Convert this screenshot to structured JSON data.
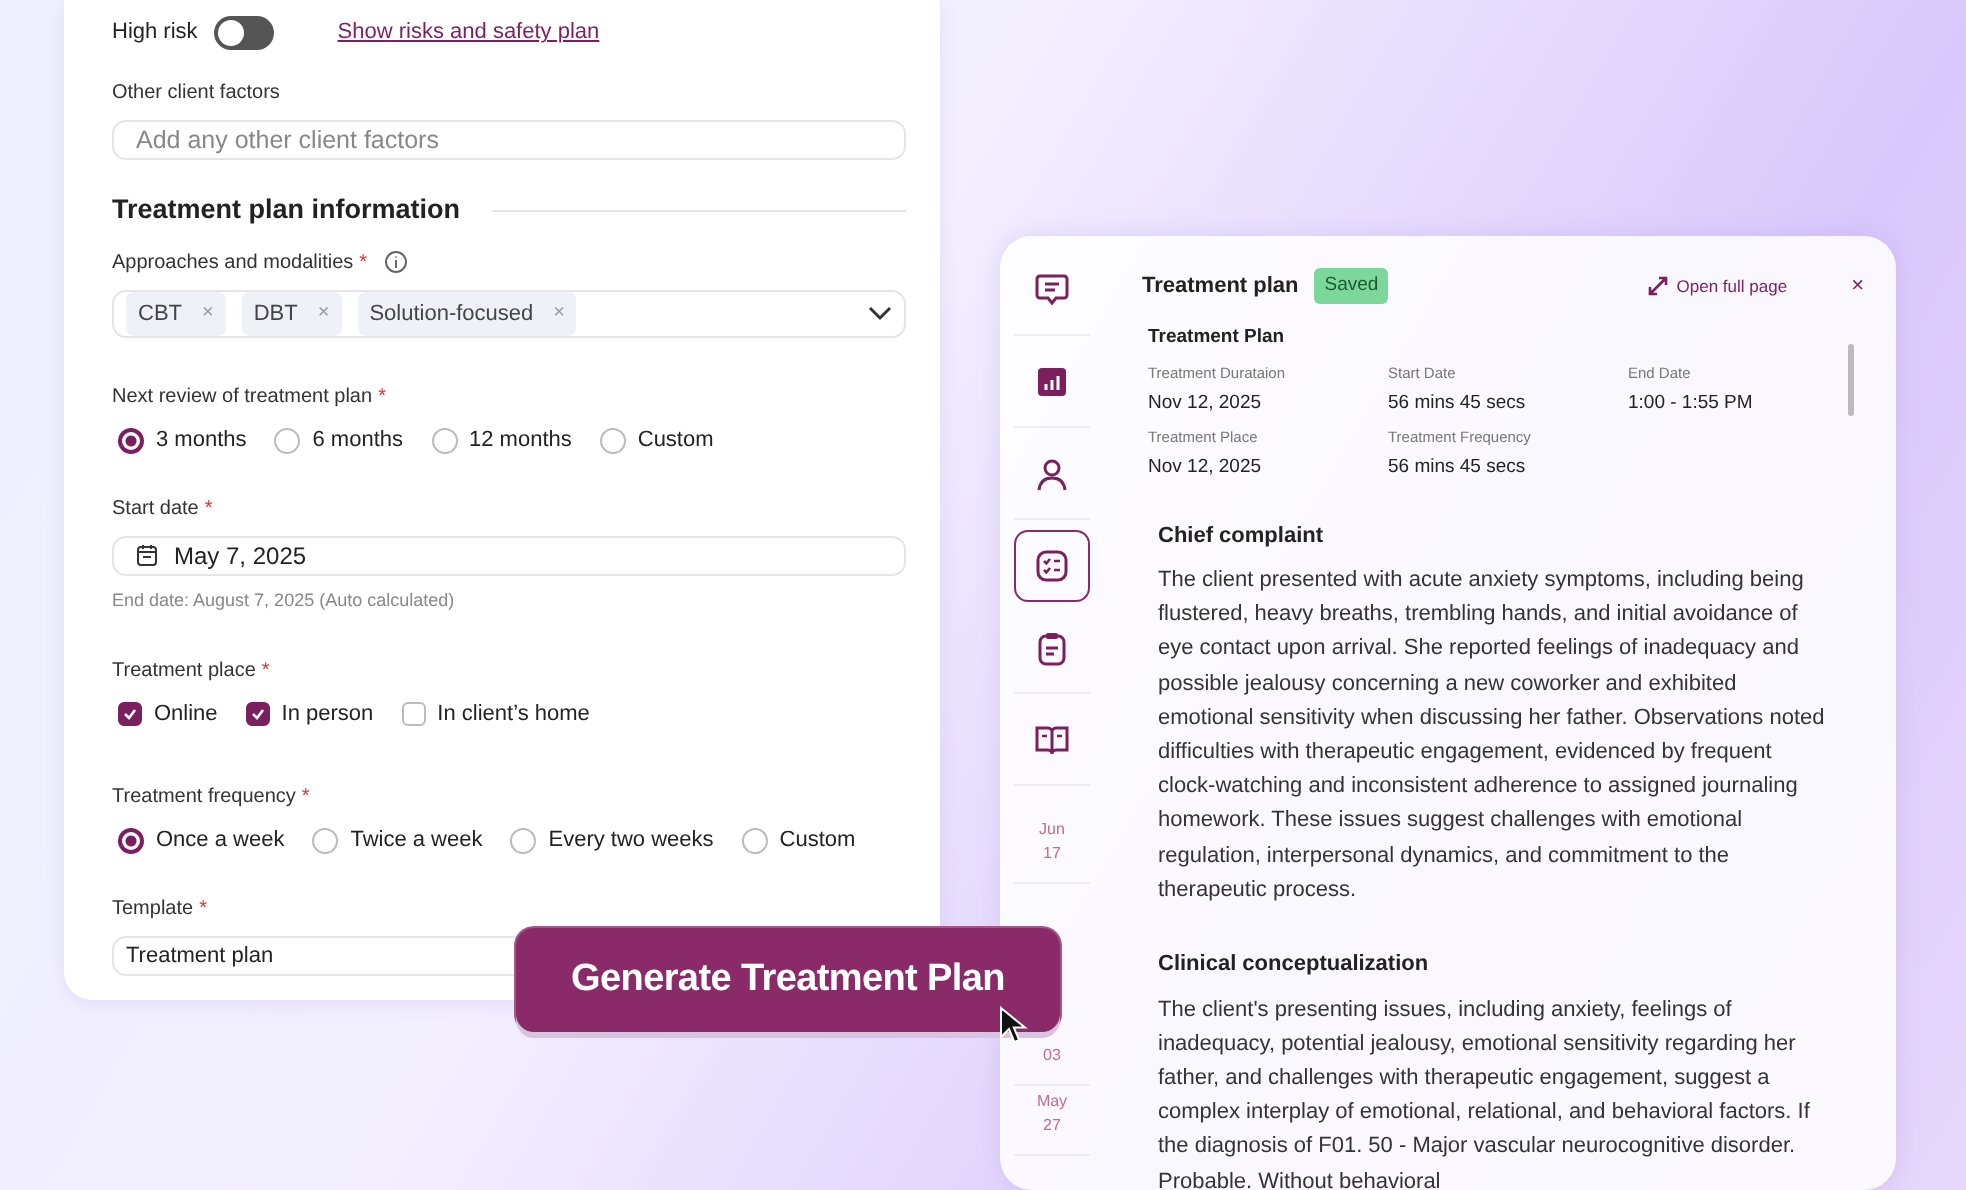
{
  "form": {
    "high_risk": {
      "label": "High risk",
      "on": false
    },
    "safety_link": "Show risks and safety plan",
    "other_factors": {
      "label": "Other client factors",
      "placeholder": "Add any other client factors"
    },
    "section_title": "Treatment plan information",
    "approaches": {
      "label": "Approaches and modalities",
      "required_mark": "*",
      "tags": [
        {
          "label": "CBT",
          "remove": "×"
        },
        {
          "label": "DBT",
          "remove": "×"
        },
        {
          "label": "Solution-focused",
          "remove": "×"
        }
      ]
    },
    "review": {
      "label": "Next review of treatment plan",
      "required_mark": "*",
      "options": [
        {
          "label": "3 months",
          "selected": true
        },
        {
          "label": "6 months",
          "selected": false
        },
        {
          "label": "12 months",
          "selected": false
        },
        {
          "label": "Custom",
          "selected": false
        }
      ]
    },
    "start_date": {
      "label": "Start date",
      "required_mark": "*",
      "value": "May 7, 2025",
      "hint": "End date: August 7, 2025 (Auto calculated)"
    },
    "place": {
      "label": "Treatment place",
      "required_mark": "*",
      "options": [
        {
          "label": "Online",
          "checked": true
        },
        {
          "label": "In person",
          "checked": true
        },
        {
          "label": "In client’s home",
          "checked": false
        }
      ]
    },
    "frequency": {
      "label": "Treatment frequency",
      "required_mark": "*",
      "options": [
        {
          "label": "Once a week",
          "selected": true
        },
        {
          "label": "Twice a week",
          "selected": false
        },
        {
          "label": "Every two weeks",
          "selected": false
        },
        {
          "label": "Custom",
          "selected": false
        }
      ]
    },
    "template": {
      "label": "Template",
      "required_mark": "*",
      "value": "Treatment plan"
    }
  },
  "generate_button": "Generate Treatment Plan",
  "panel": {
    "rail_icons": [
      {
        "selected": false
      },
      {
        "selected": false
      },
      {
        "selected": false
      },
      {
        "selected": true
      },
      {
        "selected": false
      },
      {
        "selected": false
      }
    ],
    "rail_dates": [
      {
        "month": "Jun",
        "day": "17"
      },
      {
        "day": "03"
      },
      {
        "month": "May",
        "day": "27"
      }
    ],
    "title": "Treatment plan",
    "status": "Saved",
    "open_link": "Open full page",
    "close": "×",
    "summary": {
      "heading": "Treatment Plan",
      "fields": [
        {
          "label": "Treatment Durataion",
          "value": "Nov 12, 2025"
        },
        {
          "label": "Start Date",
          "value": "56 mins 45 secs"
        },
        {
          "label": "End Date",
          "value": "1:00 - 1:55 PM"
        },
        {
          "label": "Treatment Place",
          "value": "Nov 12, 2025"
        },
        {
          "label": "Treatment Frequency",
          "value": "56 mins 45 secs"
        }
      ]
    },
    "sections": [
      {
        "heading": "Chief complaint",
        "text": "The client presented with acute anxiety symptoms, including being flustered, heavy breaths, trembling hands, and initial avoidance of eye contact upon arrival. She reported feelings of inadequacy and possible jealousy concerning a new coworker and exhibited emotional sensitivity when discussing her father. Observations noted difficulties with therapeutic engagement, evidenced by frequent clock-watching and inconsistent adherence to assigned journaling homework. These issues suggest challenges with emotional regulation, interpersonal dynamics, and commitment to the therapeutic process."
      },
      {
        "heading": "Clinical conceptualization",
        "text": "The client's presenting issues, including anxiety, feelings of inadequacy, potential jealousy, emotional sensitivity regarding her father, and challenges with therapeutic engagement, suggest a complex interplay of emotional, relational, and behavioral factors. If the diagnosis of F01. 50 - Major vascular neurocognitive disorder. Probable. Without behavioral"
      }
    ]
  }
}
